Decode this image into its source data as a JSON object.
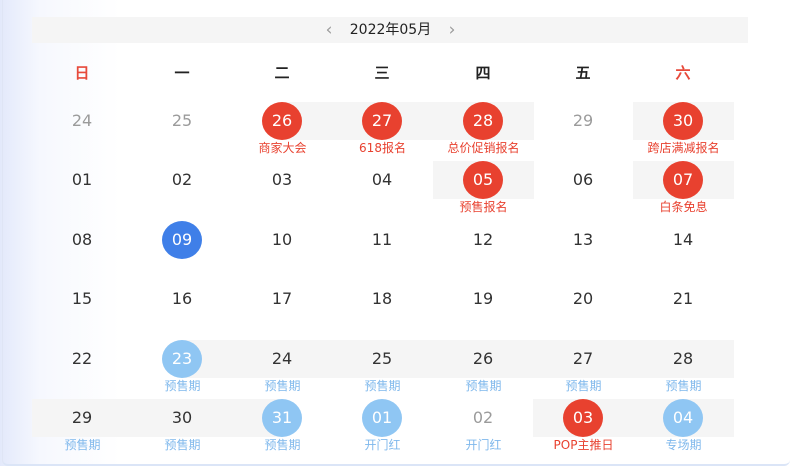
{
  "header": {
    "title": "2022年05月",
    "prev_icon": "‹",
    "next_icon": "›"
  },
  "weekdays": [
    "日",
    "一",
    "二",
    "三",
    "四",
    "五",
    "六"
  ],
  "colors": {
    "red": "#e8412f",
    "blue": "#3f7fe8",
    "light_blue": "#8fc6f3",
    "label_blue": "#7fb8ec",
    "weekend_red": "#e74a3b"
  },
  "weeks": [
    [
      {
        "day": "24",
        "style": "grey",
        "label": ""
      },
      {
        "day": "25",
        "style": "grey",
        "label": ""
      },
      {
        "day": "26",
        "style": "red",
        "label": "商家大会"
      },
      {
        "day": "27",
        "style": "red",
        "label": "618报名"
      },
      {
        "day": "28",
        "style": "red",
        "label": "总价促销报名"
      },
      {
        "day": "29",
        "style": "grey",
        "label": ""
      },
      {
        "day": "30",
        "style": "red",
        "label": "跨店满减报名"
      }
    ],
    [
      {
        "day": "01",
        "style": "normal",
        "label": ""
      },
      {
        "day": "02",
        "style": "normal",
        "label": ""
      },
      {
        "day": "03",
        "style": "normal",
        "label": ""
      },
      {
        "day": "04",
        "style": "normal",
        "label": ""
      },
      {
        "day": "05",
        "style": "red",
        "label": "预售报名"
      },
      {
        "day": "06",
        "style": "normal",
        "label": ""
      },
      {
        "day": "07",
        "style": "red",
        "label": "白条免息"
      }
    ],
    [
      {
        "day": "08",
        "style": "normal",
        "label": ""
      },
      {
        "day": "09",
        "style": "blue",
        "label": ""
      },
      {
        "day": "10",
        "style": "normal",
        "label": ""
      },
      {
        "day": "11",
        "style": "normal",
        "label": ""
      },
      {
        "day": "12",
        "style": "normal",
        "label": ""
      },
      {
        "day": "13",
        "style": "normal",
        "label": ""
      },
      {
        "day": "14",
        "style": "normal",
        "label": ""
      }
    ],
    [
      {
        "day": "15",
        "style": "normal",
        "label": ""
      },
      {
        "day": "16",
        "style": "normal",
        "label": ""
      },
      {
        "day": "17",
        "style": "normal",
        "label": ""
      },
      {
        "day": "18",
        "style": "normal",
        "label": ""
      },
      {
        "day": "19",
        "style": "normal",
        "label": ""
      },
      {
        "day": "20",
        "style": "normal",
        "label": ""
      },
      {
        "day": "21",
        "style": "normal",
        "label": ""
      }
    ],
    [
      {
        "day": "22",
        "style": "normal",
        "label": ""
      },
      {
        "day": "23",
        "style": "light",
        "label": "预售期"
      },
      {
        "day": "24",
        "style": "normal",
        "label": "预售期"
      },
      {
        "day": "25",
        "style": "normal",
        "label": "预售期"
      },
      {
        "day": "26",
        "style": "normal",
        "label": "预售期"
      },
      {
        "day": "27",
        "style": "normal",
        "label": "预售期"
      },
      {
        "day": "28",
        "style": "normal",
        "label": "预售期"
      }
    ],
    [
      {
        "day": "29",
        "style": "normal",
        "label": "预售期"
      },
      {
        "day": "30",
        "style": "normal",
        "label": "预售期"
      },
      {
        "day": "31",
        "style": "light",
        "label": "预售期"
      },
      {
        "day": "01",
        "style": "light",
        "label": "开门红"
      },
      {
        "day": "02",
        "style": "grey",
        "label": "开门红"
      },
      {
        "day": "03",
        "style": "red",
        "label": "POP主推日"
      },
      {
        "day": "04",
        "style": "light",
        "label": "专场期"
      }
    ]
  ]
}
